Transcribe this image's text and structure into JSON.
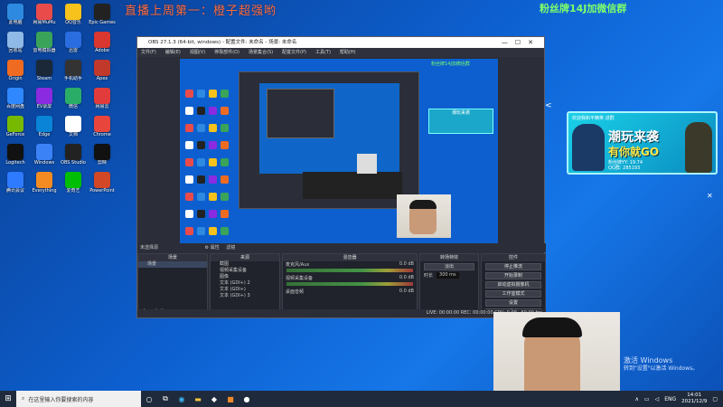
{
  "overlay": {
    "title": "直播上周第一：橙子超强哟",
    "right_text": "粉丝牌14J加微信群"
  },
  "desktop_icons": [
    {
      "label": "此电脑",
      "color": "#2d8ae0"
    },
    {
      "label": "网易MuMu",
      "color": "#e94b4b"
    },
    {
      "label": "QQ音乐",
      "color": "#f6c21b"
    },
    {
      "label": "Epic Games",
      "color": "#222"
    },
    {
      "label": "回收站",
      "color": "#8fb9e6"
    },
    {
      "label": "雷电模拟器",
      "color": "#3aa35a"
    },
    {
      "label": "迅雷",
      "color": "#2a6de0"
    },
    {
      "label": "Adobe",
      "color": "#d9372f"
    },
    {
      "label": "Origin",
      "color": "#f06b22"
    },
    {
      "label": "Steam",
      "color": "#1b2838"
    },
    {
      "label": "手机助手",
      "color": "#333"
    },
    {
      "label": "Apex",
      "color": "#c0392b"
    },
    {
      "label": "百度网盘",
      "color": "#2f88ff"
    },
    {
      "label": "EV录屏",
      "color": "#8a2be2"
    },
    {
      "label": "微信",
      "color": "#2aae67"
    },
    {
      "label": "网易云",
      "color": "#e23b3b"
    },
    {
      "label": "GeForce",
      "color": "#76b900"
    },
    {
      "label": "Edge",
      "color": "#0a84d6"
    },
    {
      "label": "文档",
      "color": "#fff"
    },
    {
      "label": "Chrome",
      "color": "#e8453c"
    },
    {
      "label": "Logitech",
      "color": "#111"
    },
    {
      "label": "Windows",
      "color": "#3b82f6"
    },
    {
      "label": "OBS Studio",
      "color": "#222"
    },
    {
      "label": "剪映",
      "color": "#111"
    },
    {
      "label": "腾讯会议",
      "color": "#2f7bff"
    },
    {
      "label": "Everything",
      "color": "#f48b22"
    },
    {
      "label": "爱奇艺",
      "color": "#00be06"
    },
    {
      "label": "PowerPoint",
      "color": "#d24726"
    }
  ],
  "obs": {
    "title": "OBS 27.1.3 (64-bit, windows) - 配置文件: 未命名 - 场景: 未命名",
    "menu": [
      "文件(F)",
      "编辑(E)",
      "视图(V)",
      "停靠部件(D)",
      "场景集合(S)",
      "配置文件(P)",
      "工具(T)",
      "帮助(H)"
    ],
    "scene_label": "粉丝牌14J加微信群",
    "no_source": "未选择源",
    "props_btn": "属性",
    "filters_btn": "滤镜",
    "docks": {
      "scenes": {
        "title": "场景",
        "items": [
          "场景"
        ]
      },
      "sources": {
        "title": "来源",
        "items": [
          "截图",
          "视频采集设备",
          "图像",
          "文本 (GDI+) 2",
          "文本 (GDI+)",
          "文本 (GDI+) 3"
        ]
      },
      "mixer": {
        "title": "混音器",
        "tracks": [
          {
            "name": "麦克风/Aux",
            "level": "0.0 dB"
          },
          {
            "name": "视频采集设备",
            "level": "0.0 dB"
          },
          {
            "name": "桌面音频",
            "level": "0.0 dB"
          }
        ]
      },
      "transitions": {
        "title": "转场特效",
        "type": "淡出",
        "duration_label": "时长",
        "duration": "300 ms"
      },
      "controls": {
        "title": "控件",
        "buttons": [
          "停止推流",
          "开始录制",
          "启动虚拟摄像机",
          "工作室模式",
          "设置",
          "退出"
        ]
      }
    },
    "status": "LIVE: 00:00:00   REC: 00:00:00   CPU: 0.0%, 60.00 fps"
  },
  "banner": {
    "tag": "欢迎我和平精英 进群",
    "line1": "潮玩来袭",
    "line2": "有你就GO",
    "info1": "粉丝牌YY: 19.74",
    "info2": "QQ群: 285193"
  },
  "activate": {
    "title": "激活 Windows",
    "sub": "转到\"设置\"以激活 Windows。"
  },
  "taskbar": {
    "search_placeholder": "在这里输入你要搜索的内容",
    "lang": "ENG",
    "time": "14:01",
    "date": "2021/12/9"
  }
}
